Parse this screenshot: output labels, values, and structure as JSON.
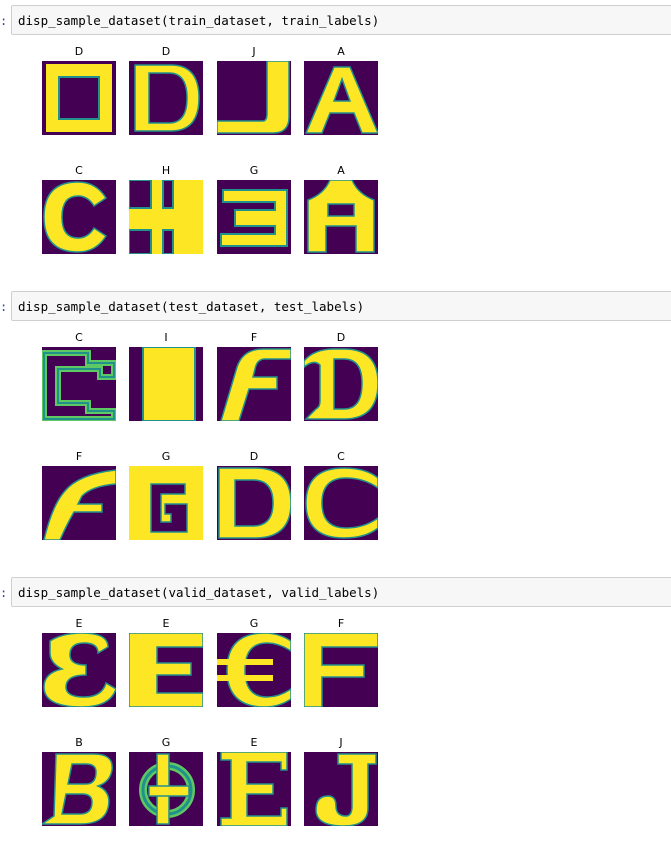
{
  "colors": {
    "bg": "#440154",
    "fg": "#fde725",
    "edge_teal": "#21918c",
    "edge_green": "#5ec962",
    "prompt": "#303f9f"
  },
  "cells": [
    {
      "prompt": ":",
      "code": "disp_sample_dataset(train_dataset, train_labels)",
      "labels": [
        "D",
        "D",
        "J",
        "A",
        "C",
        "H",
        "G",
        "A"
      ]
    },
    {
      "prompt": ":",
      "code": "disp_sample_dataset(test_dataset, test_labels)",
      "labels": [
        "C",
        "I",
        "F",
        "D",
        "F",
        "G",
        "D",
        "C"
      ]
    },
    {
      "prompt": ":",
      "code": "disp_sample_dataset(valid_dataset, valid_labels)",
      "labels": [
        "E",
        "E",
        "G",
        "F",
        "B",
        "G",
        "E",
        "J"
      ]
    }
  ]
}
